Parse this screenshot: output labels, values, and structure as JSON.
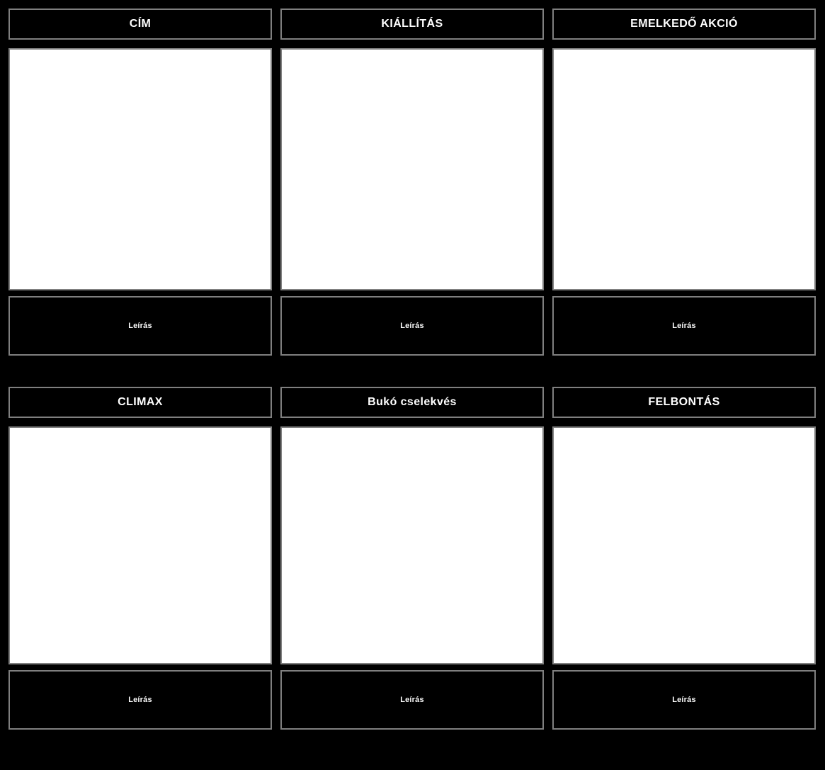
{
  "board": {
    "background_color": "#000000",
    "border_color": "#7f7f7f",
    "text_color": "#ffffff",
    "image_fill_color": "#ffffff",
    "rows": [
      {
        "panels": [
          {
            "header": "CÍM",
            "caption": "Leírás"
          },
          {
            "header": "KIÁLLÍTÁS",
            "caption": "Leírás"
          },
          {
            "header": "EMELKEDŐ AKCIÓ",
            "caption": "Leírás"
          }
        ]
      },
      {
        "panels": [
          {
            "header": "CLIMAX",
            "caption": "Leírás"
          },
          {
            "header": "Bukó cselekvés",
            "caption": "Leírás"
          },
          {
            "header": "FELBONTÁS",
            "caption": "Leírás"
          }
        ]
      }
    ]
  }
}
